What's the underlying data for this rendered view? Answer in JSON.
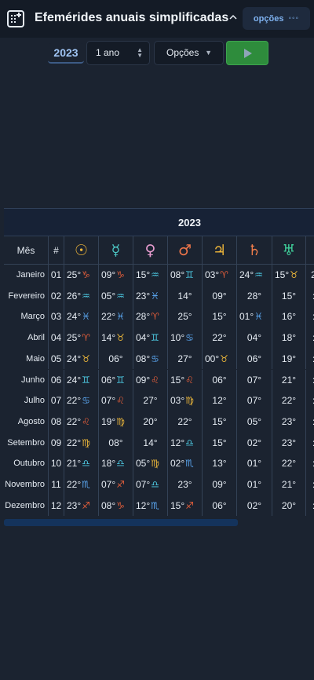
{
  "header": {
    "title": "Efemérides anuais simplificadas",
    "collapse_icon": "chevron-up-icon",
    "options_label": "opções",
    "options_dots": "◦◦◦"
  },
  "toolbar": {
    "year": "2023",
    "period": "1 ano",
    "options_select": "Opções",
    "run_icon": "play-icon"
  },
  "table": {
    "year_title": "2023",
    "col_month": "Mês",
    "col_num": "#",
    "planets": [
      {
        "glyph": "☉",
        "name": "sun",
        "color": "#f0b73a"
      },
      {
        "glyph": "☿",
        "name": "mercury",
        "color": "#4cc7c5"
      },
      {
        "glyph": "♀",
        "name": "venus",
        "color": "#e79ccf"
      },
      {
        "glyph": "♂",
        "name": "mars",
        "color": "#f0764a"
      },
      {
        "glyph": "♃",
        "name": "jupiter",
        "color": "#f0b73a"
      },
      {
        "glyph": "♄",
        "name": "saturn",
        "color": "#ee7c4a"
      },
      {
        "glyph": "♅",
        "name": "uranus",
        "color": "#3fcf9a"
      }
    ],
    "rows": [
      {
        "month": "Janeiro",
        "n": "01",
        "p": [
          [
            "25°",
            "♑",
            "#e05d3a"
          ],
          [
            "09°",
            "♑",
            "#e05d3a"
          ],
          [
            "15°",
            "♒",
            "#4cc7e0"
          ],
          [
            "08°",
            "♊",
            "#4cc7e0"
          ],
          [
            "03°",
            "♈",
            "#e05d3a"
          ],
          [
            "24°",
            "♒",
            "#4cc7e0"
          ],
          [
            "15°",
            "♉",
            "#e8b43a"
          ]
        ],
        "extra": "2"
      },
      {
        "month": "Fevereiro",
        "n": "02",
        "p": [
          [
            "26°",
            "♒",
            "#4cc7e0"
          ],
          [
            "05°",
            "♒",
            "#4cc7e0"
          ],
          [
            "23°",
            "♓",
            "#5aa6f0"
          ],
          [
            "14°",
            "",
            ""
          ],
          [
            "09°",
            "",
            ""
          ],
          [
            "28°",
            "",
            ""
          ],
          [
            "15°",
            "",
            ""
          ]
        ],
        "extra": ":"
      },
      {
        "month": "Março",
        "n": "03",
        "p": [
          [
            "24°",
            "♓",
            "#5aa6f0"
          ],
          [
            "22°",
            "♓",
            "#5aa6f0"
          ],
          [
            "28°",
            "♈",
            "#e05d3a"
          ],
          [
            "25°",
            "",
            ""
          ],
          [
            "15°",
            "",
            ""
          ],
          [
            "01°",
            "♓",
            "#5aa6f0"
          ],
          [
            "16°",
            "",
            ""
          ]
        ],
        "extra": ":"
      },
      {
        "month": "Abril",
        "n": "04",
        "p": [
          [
            "25°",
            "♈",
            "#e05d3a"
          ],
          [
            "14°",
            "♉",
            "#e8b43a"
          ],
          [
            "04°",
            "♊",
            "#4cc7e0"
          ],
          [
            "10°",
            "♋",
            "#5aa6f0"
          ],
          [
            "22°",
            "",
            ""
          ],
          [
            "04°",
            "",
            ""
          ],
          [
            "18°",
            "",
            ""
          ]
        ],
        "extra": ":"
      },
      {
        "month": "Maio",
        "n": "05",
        "p": [
          [
            "24°",
            "♉",
            "#e8b43a"
          ],
          [
            "06°",
            "",
            ""
          ],
          [
            "08°",
            "♋",
            "#5aa6f0"
          ],
          [
            "27°",
            "",
            ""
          ],
          [
            "00°",
            "♉",
            "#e8b43a"
          ],
          [
            "06°",
            "",
            ""
          ],
          [
            "19°",
            "",
            ""
          ]
        ],
        "extra": ":"
      },
      {
        "month": "Junho",
        "n": "06",
        "p": [
          [
            "24°",
            "♊",
            "#4cc7e0"
          ],
          [
            "06°",
            "♊",
            "#4cc7e0"
          ],
          [
            "09°",
            "♌",
            "#e05d3a"
          ],
          [
            "15°",
            "♌",
            "#e05d3a"
          ],
          [
            "06°",
            "",
            ""
          ],
          [
            "07°",
            "",
            ""
          ],
          [
            "21°",
            "",
            ""
          ]
        ],
        "extra": ":"
      },
      {
        "month": "Julho",
        "n": "07",
        "p": [
          [
            "22°",
            "♋",
            "#5aa6f0"
          ],
          [
            "07°",
            "♌",
            "#e05d3a"
          ],
          [
            "27°",
            "",
            ""
          ],
          [
            "03°",
            "♍",
            "#e8b43a"
          ],
          [
            "12°",
            "",
            ""
          ],
          [
            "07°",
            "",
            ""
          ],
          [
            "22°",
            "",
            ""
          ]
        ],
        "extra": ":"
      },
      {
        "month": "Agosto",
        "n": "08",
        "p": [
          [
            "22°",
            "♌",
            "#e05d3a"
          ],
          [
            "19°",
            "♍",
            "#e8b43a"
          ],
          [
            "20°",
            "",
            ""
          ],
          [
            "22°",
            "",
            ""
          ],
          [
            "15°",
            "",
            ""
          ],
          [
            "05°",
            "",
            ""
          ],
          [
            "23°",
            "",
            ""
          ]
        ],
        "extra": ":"
      },
      {
        "month": "Setembro",
        "n": "09",
        "p": [
          [
            "22°",
            "♍",
            "#e8b43a"
          ],
          [
            "08°",
            "",
            ""
          ],
          [
            "14°",
            "",
            ""
          ],
          [
            "12°",
            "♎",
            "#4cc7e0"
          ],
          [
            "15°",
            "",
            ""
          ],
          [
            "02°",
            "",
            ""
          ],
          [
            "23°",
            "",
            ""
          ]
        ],
        "extra": ":"
      },
      {
        "month": "Outubro",
        "n": "10",
        "p": [
          [
            "21°",
            "♎",
            "#4cc7e0"
          ],
          [
            "18°",
            "♎",
            "#4cc7e0"
          ],
          [
            "05°",
            "♍",
            "#e8b43a"
          ],
          [
            "02°",
            "♏",
            "#5aa6f0"
          ],
          [
            "13°",
            "",
            ""
          ],
          [
            "01°",
            "",
            ""
          ],
          [
            "22°",
            "",
            ""
          ]
        ],
        "extra": ":"
      },
      {
        "month": "Novembro",
        "n": "11",
        "p": [
          [
            "22°",
            "♏",
            "#5aa6f0"
          ],
          [
            "07°",
            "♐",
            "#e05d3a"
          ],
          [
            "07°",
            "♎",
            "#4cc7e0"
          ],
          [
            "23°",
            "",
            ""
          ],
          [
            "09°",
            "",
            ""
          ],
          [
            "01°",
            "",
            ""
          ],
          [
            "21°",
            "",
            ""
          ]
        ],
        "extra": ":"
      },
      {
        "month": "Dezembro",
        "n": "12",
        "p": [
          [
            "23°",
            "♐",
            "#e05d3a"
          ],
          [
            "08°",
            "♑",
            "#e05d3a"
          ],
          [
            "12°",
            "♏",
            "#5aa6f0"
          ],
          [
            "15°",
            "♐",
            "#e05d3a"
          ],
          [
            "06°",
            "",
            ""
          ],
          [
            "02°",
            "",
            ""
          ],
          [
            "20°",
            "",
            ""
          ]
        ],
        "extra": ":"
      }
    ]
  }
}
